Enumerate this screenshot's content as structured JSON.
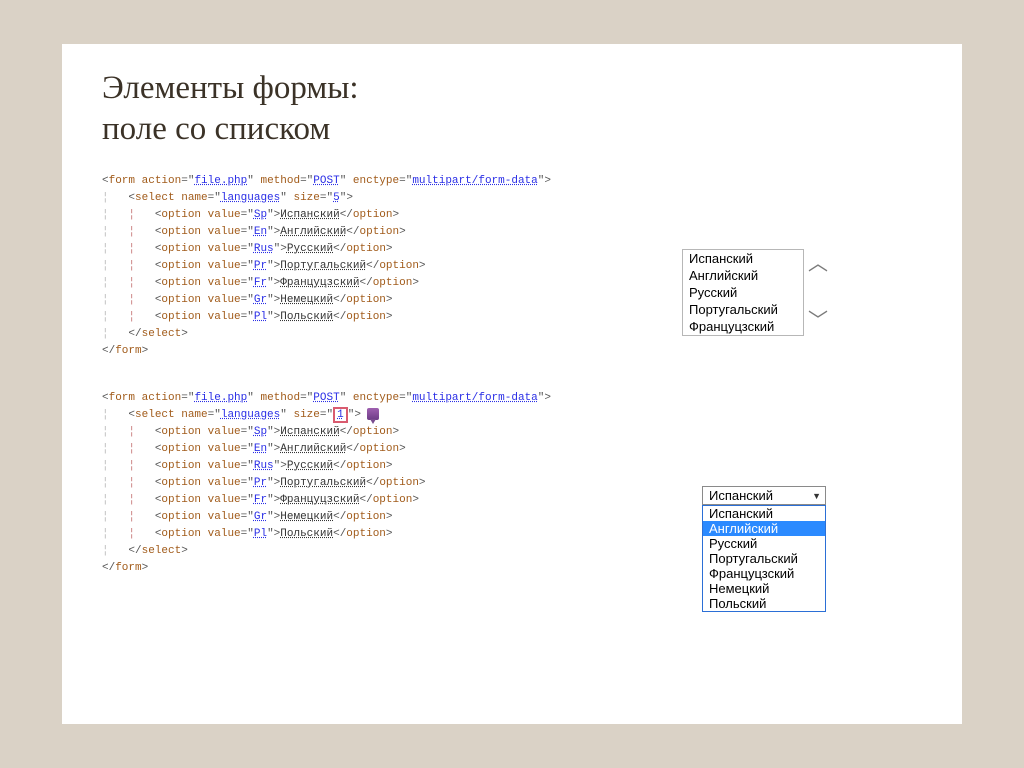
{
  "title_line1": "Элементы формы:",
  "title_line2": "поле со списком",
  "code1": {
    "form_tag": "form",
    "action_attr": "action",
    "action_val": "file.php",
    "method_attr": "method",
    "method_val": "POST",
    "enctype_attr": "enctype",
    "enctype_val": "multipart/form-data",
    "select_tag": "select",
    "name_attr": "name",
    "name_val": "languages",
    "size_attr": "size",
    "size_val": "5",
    "option_tag": "option",
    "value_attr": "value",
    "options": [
      {
        "val": "Sp",
        "text": "Испанский"
      },
      {
        "val": "En",
        "text": "Английский"
      },
      {
        "val": "Rus",
        "text": "Русский"
      },
      {
        "val": "Pr",
        "text": "Португальский"
      },
      {
        "val": "Fr",
        "text": "Француцзский"
      },
      {
        "val": "Gr",
        "text": "Немецкий"
      },
      {
        "val": "Pl",
        "text": "Польский"
      }
    ],
    "end_select": "select",
    "end_form": "form"
  },
  "code2": {
    "size_val": "1"
  },
  "listbox": {
    "items": [
      "Испанский",
      "Английский",
      "Русский",
      "Португальский",
      "Француцзский"
    ]
  },
  "dropdown": {
    "selected": "Испанский",
    "items": [
      "Испанский",
      "Английский",
      "Русский",
      "Португальский",
      "Француцзский",
      "Немецкий",
      "Польский"
    ],
    "highlighted_index": 1
  }
}
